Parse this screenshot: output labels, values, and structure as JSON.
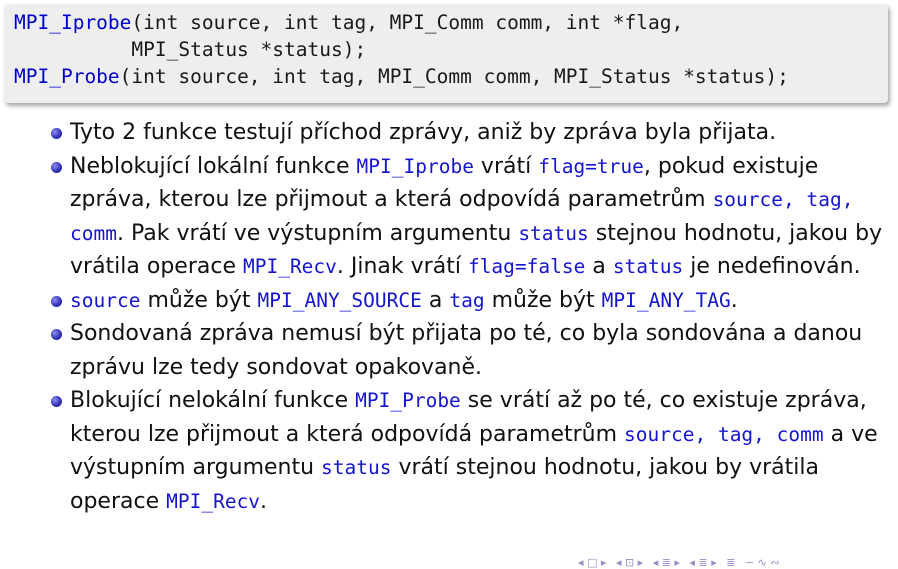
{
  "code": {
    "line1": {
      "fn": "MPI_Iprobe",
      "args": "(int source, int tag, MPI_Comm comm, int *flag,"
    },
    "line2": "          MPI_Status *status);",
    "line3": {
      "fn": "MPI_Probe",
      "args": "(int source, int tag, MPI_Comm comm, MPI_Status *status);"
    }
  },
  "bullets": [
    {
      "t1": "Tyto 2 funkce testují příchod zprávy, aniž by zpráva byla přijata."
    },
    {
      "t1": "Neblokující lokální funkce ",
      "c1": "MPI_Iprobe",
      "t2": " vrátí ",
      "c2": "flag=true",
      "t3": ", pokud existuje zpráva, kterou lze přijmout a která odpovídá parametrům ",
      "c3": "source, tag, comm",
      "t4": ". Pak vrátí ve výstupním argumentu ",
      "c4": "status",
      "t5": " stejnou hodnotu, jakou by vrátila operace ",
      "c5": "MPI_Recv",
      "t6": ". Jinak vrátí ",
      "c6": "flag=false",
      "t7": " a ",
      "c7": "status",
      "t8": " je nedefinován."
    },
    {
      "c1": "source",
      "t1": " může být ",
      "c2": "MPI_ANY_SOURCE",
      "t2": " a ",
      "c3": "tag",
      "t3": " může být ",
      "c4": "MPI_ANY_TAG",
      "t4": "."
    },
    {
      "t1": "Sondovaná zpráva nemusí být přijata po té, co byla sondována a danou zprávu lze tedy sondovat opakovaně."
    },
    {
      "t1": "Blokující nelokální funkce ",
      "c1": "MPI_Probe",
      "t2": " se vrátí až po té, co existuje zpráva, kterou lze přijmout a která odpovídá parametrům ",
      "c2": "source, tag, comm",
      "t3": " a ve výstupním argumentu ",
      "c3": "status",
      "t4": " vrátí stejnou hodnotu, jakou by vrátila operace ",
      "c4": "MPI_Recv",
      "t5": "."
    }
  ],
  "nav_glyphs": [
    "◂ □ ▸",
    "◂ ⊡ ▸",
    "◂ ≣ ▸",
    "◂ ≣ ▸",
    "≣",
    "∽ ∿ ∾"
  ]
}
